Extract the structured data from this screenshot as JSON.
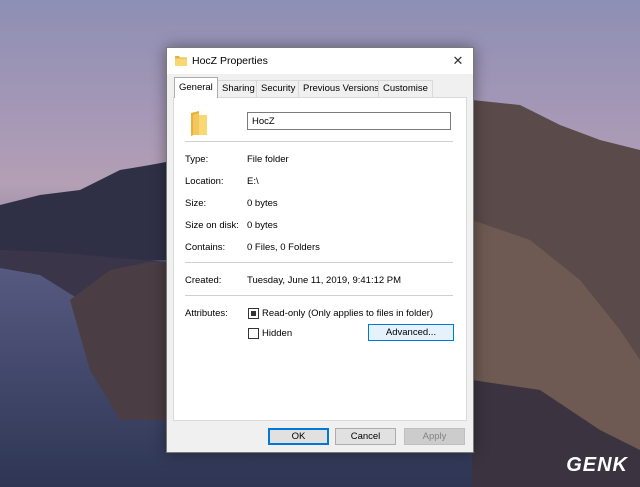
{
  "window": {
    "title": "HocZ Properties",
    "close_glyph": "✕"
  },
  "tabs": [
    "General",
    "Sharing",
    "Security",
    "Previous Versions",
    "Customise"
  ],
  "name_field": {
    "value": "HocZ"
  },
  "info": [
    {
      "label": "Type:",
      "value": "File folder"
    },
    {
      "label": "Location:",
      "value": "E:\\"
    },
    {
      "label": "Size:",
      "value": "0 bytes"
    },
    {
      "label": "Size on disk:",
      "value": "0 bytes"
    },
    {
      "label": "Contains:",
      "value": "0 Files, 0 Folders"
    }
  ],
  "created": {
    "label": "Created:",
    "value": "Tuesday, June 11, 2019, 9:41:12 PM"
  },
  "attributes": {
    "label": "Attributes:",
    "readonly": {
      "label": "Read-only (Only applies to files in folder)",
      "state": "indeterminate"
    },
    "hidden": {
      "label": "Hidden",
      "checked": false
    },
    "advanced_label": "Advanced..."
  },
  "buttons": {
    "ok": "OK",
    "cancel": "Cancel",
    "apply": "Apply"
  },
  "watermark": "GENK",
  "colors": {
    "accent": "#0078d7",
    "annotation_arrow": "#e0202a"
  }
}
